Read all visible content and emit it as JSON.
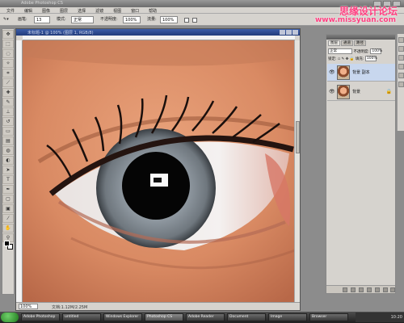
{
  "app": {
    "title": "Adobe Photoshop CS",
    "title_center": ""
  },
  "watermark": {
    "line1": "思缘设计论坛",
    "line2": "www.missyuan.com"
  },
  "menu": {
    "items": [
      "文件",
      "编辑",
      "图像",
      "图层",
      "选择",
      "滤镜",
      "视图",
      "窗口",
      "帮助"
    ]
  },
  "options": {
    "brush_label": "画笔:",
    "brush_size": "13",
    "mode_label": "模式:",
    "mode_value": "正常",
    "opacity_label": "不透明度:",
    "opacity_value": "100%",
    "flow_label": "流量:",
    "flow_value": "100%"
  },
  "document": {
    "title": "未标题-1 @ 100% (图层 1, RGB/8)",
    "zoom": "100%",
    "status": "文档:1.12M/2.25M"
  },
  "layers": {
    "tabs": [
      "图层",
      "通道",
      "路径"
    ],
    "blend_mode": "正常",
    "opacity_label": "不透明度:",
    "opacity": "100%",
    "lock_label": "锁定:",
    "fill_label": "填充:",
    "fill": "100%",
    "items": [
      {
        "name": "背景 副本",
        "selected": true
      },
      {
        "name": "背景",
        "selected": false
      }
    ]
  },
  "taskbar": {
    "tasks": [
      "Adobe Photoshop",
      "untitled",
      "Windows Explorer",
      "Photoshop CS",
      "Adobe Reader",
      "Document",
      "Image",
      "Browser"
    ],
    "time": "10:20"
  },
  "colors": {
    "accent": "#ff3d7f",
    "doc_title": "#223c7b",
    "selected_layer": "#c8d7ee"
  }
}
